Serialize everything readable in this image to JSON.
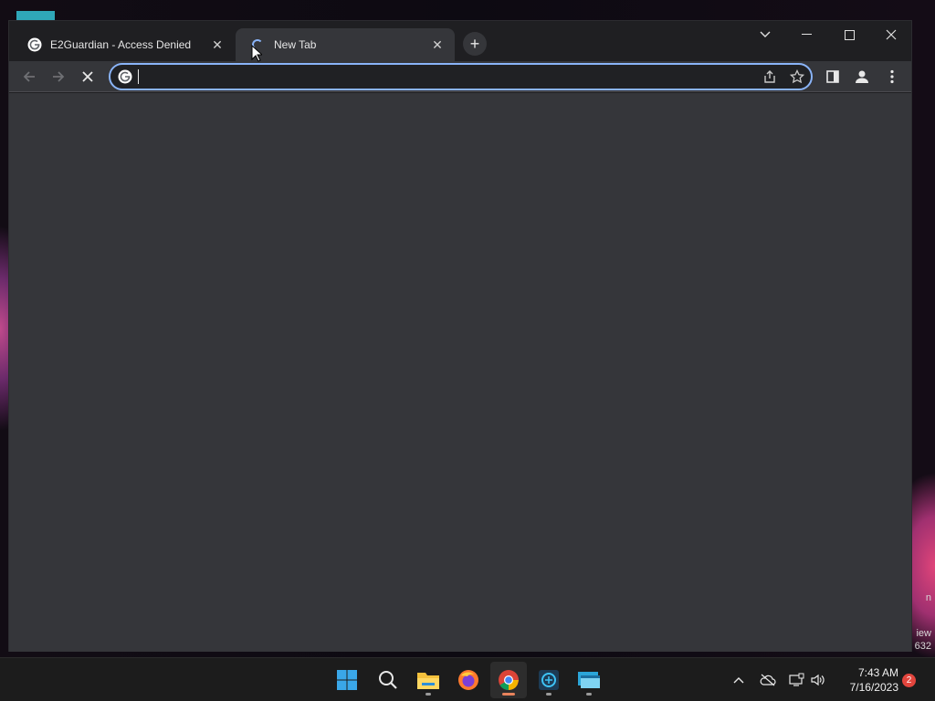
{
  "browser": {
    "tabs": [
      {
        "title": "E2Guardian - Access Denied",
        "icon": "google-g-icon",
        "active": false
      },
      {
        "title": "New Tab",
        "icon": "loading-spinner-icon",
        "active": true
      }
    ],
    "new_tab_icon": "plus-icon",
    "window_controls": [
      "tab-search-icon",
      "minimize-icon",
      "maximize-icon",
      "close-icon"
    ],
    "toolbar": {
      "back_icon": "arrow-left-icon",
      "forward_icon": "arrow-right-icon",
      "stop_icon": "stop-x-icon",
      "share_icon": "share-icon",
      "bookmark_icon": "star-icon",
      "side_panel_icon": "side-panel-icon",
      "profile_icon": "profile-icon",
      "menu_icon": "kebab-menu-icon"
    },
    "omnibox": {
      "value": "",
      "favicon": "google-g-icon"
    },
    "accent_color": "#8ab4f8",
    "content_background": "#35363a"
  },
  "desktop": {
    "peek_texts": [
      "n",
      "iew",
      "632"
    ]
  },
  "taskbar": {
    "apps": [
      {
        "name": "start",
        "icon": "windows-start-icon",
        "running": false
      },
      {
        "name": "search",
        "icon": "search-icon",
        "running": false
      },
      {
        "name": "file-explorer",
        "icon": "folder-icon",
        "running": true
      },
      {
        "name": "firefox",
        "icon": "firefox-icon",
        "running": false
      },
      {
        "name": "chrome",
        "icon": "chrome-icon",
        "running": true,
        "active": true
      },
      {
        "name": "app-6",
        "icon": "app-icon",
        "running": true
      },
      {
        "name": "remote-desktop",
        "icon": "remote-desktop-icon",
        "running": true
      }
    ],
    "tray": {
      "icons": [
        "chevron-up-icon",
        "cloud-offline-icon",
        "network-icon",
        "volume-icon"
      ],
      "time": "7:43 AM",
      "date": "7/16/2023",
      "notification_count": "2"
    }
  }
}
